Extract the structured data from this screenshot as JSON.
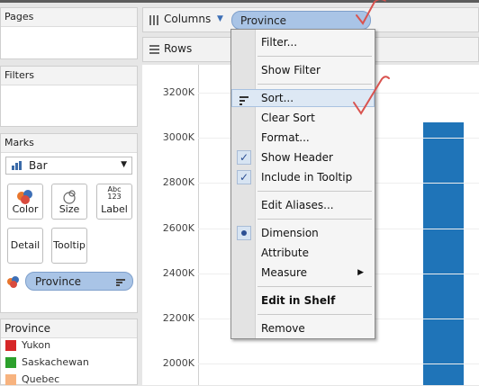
{
  "panels": {
    "pages": {
      "title": "Pages"
    },
    "filters": {
      "title": "Filters"
    },
    "marks": {
      "title": "Marks",
      "mark_type": "Bar",
      "buttons": {
        "color": "Color",
        "size": "Size",
        "label": "Label",
        "detail": "Detail",
        "tooltip": "Tooltip"
      },
      "label_icon_text": "Abc\n123",
      "field_pill": "Province"
    },
    "legend": {
      "title": "Province",
      "items": [
        {
          "label": "Yukon",
          "color": "#d62728"
        },
        {
          "label": "Saskachewan",
          "color": "#2ca02c"
        },
        {
          "label": "Quebec",
          "color": "#f7b37f"
        }
      ]
    }
  },
  "shelves": {
    "columns": {
      "label": "Columns",
      "pill": "Province"
    },
    "rows": {
      "label": "Rows"
    }
  },
  "chart_data": {
    "type": "bar",
    "y_ticks": [
      "3200K",
      "3000K",
      "2800K",
      "2600K",
      "2400K",
      "2200K",
      "2000K"
    ],
    "ylim": [
      1900000,
      3300000
    ],
    "visible_bar_top_value": 3070000,
    "bar_color": "#1f74b8"
  },
  "context_menu": {
    "items": [
      {
        "label": "Filter...",
        "checked": false,
        "bold": false,
        "highlight": false
      },
      {
        "label": "Show Filter",
        "checked": false,
        "bold": false,
        "highlight": false
      },
      {
        "label": "Sort...",
        "checked": false,
        "bold": false,
        "highlight": true,
        "icon": "sort-icon"
      },
      {
        "label": "Clear Sort",
        "checked": false,
        "bold": false,
        "highlight": false
      },
      {
        "label": "Format...",
        "checked": false,
        "bold": false,
        "highlight": false
      },
      {
        "label": "Show Header",
        "checked": true,
        "bold": false,
        "highlight": false
      },
      {
        "label": "Include in Tooltip",
        "checked": true,
        "bold": false,
        "highlight": false
      },
      {
        "label": "Edit Aliases...",
        "checked": false,
        "bold": false,
        "highlight": false
      },
      {
        "label": "Dimension",
        "checked": false,
        "radio": true,
        "bold": false,
        "highlight": false
      },
      {
        "label": "Attribute",
        "checked": false,
        "bold": false,
        "highlight": false
      },
      {
        "label": "Measure",
        "checked": false,
        "bold": false,
        "highlight": false,
        "submenu": true
      },
      {
        "label": "Edit in Shelf",
        "checked": false,
        "bold": true,
        "highlight": false
      },
      {
        "label": "Remove",
        "checked": false,
        "bold": false,
        "highlight": false
      }
    ]
  },
  "colors": {
    "pill": "#a9c4e6",
    "annotation": "#d9534f",
    "menu_highlight": "#dde8f4"
  }
}
